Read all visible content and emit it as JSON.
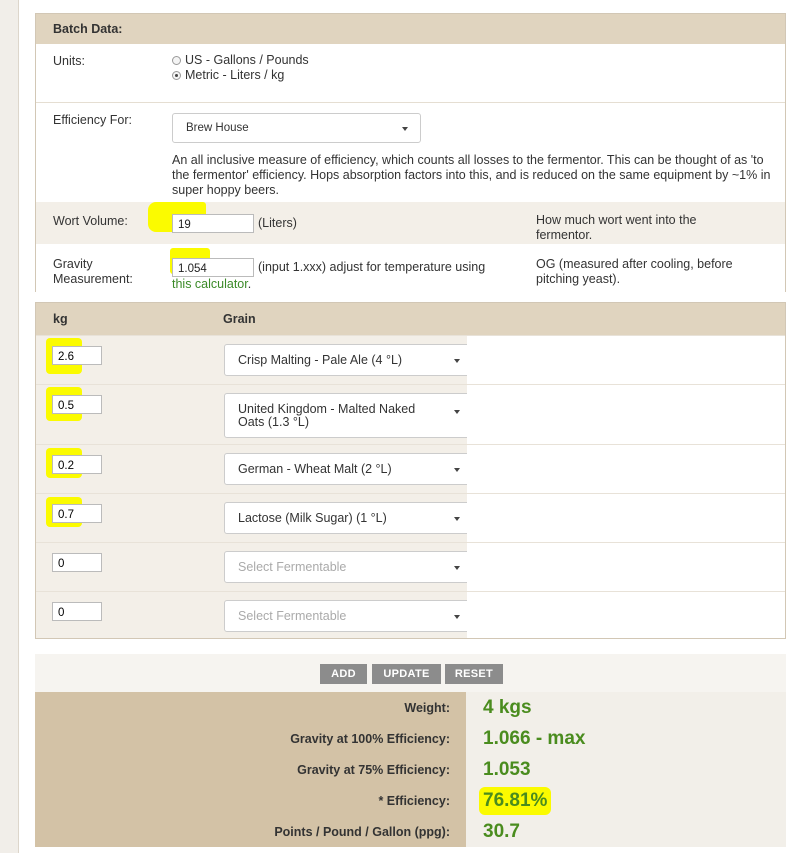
{
  "batch": {
    "header": "Batch Data:",
    "units": {
      "label": "Units:",
      "options": [
        "US - Gallons / Pounds",
        "Metric - Liters / kg"
      ],
      "selected_index": 1
    },
    "efficiency": {
      "label": "Efficiency For:",
      "selected": "Brew House",
      "description": "An all inclusive measure of efficiency, which counts all losses to the fermentor. This can be thought of as 'to the fermentor' efficiency. Hops absorption factors into this, and is reduced on the same equipment by ~1% in super hoppy beers."
    },
    "wort_volume": {
      "label": "Wort Volume:",
      "value": "19",
      "unit": "(Liters)",
      "note": "How much wort went into the fermentor."
    },
    "gravity": {
      "label": "Gravity Measurement:",
      "value": "1.054",
      "hint": "(input 1.xxx) adjust for temperature using",
      "link": "this calculator",
      "link_suffix": ".",
      "note": "OG (measured after cooling, before pitching yeast)."
    }
  },
  "grain_table": {
    "headers": {
      "kg": "kg",
      "grain": "Grain"
    },
    "rows": [
      {
        "kg": "2.6",
        "grain": "Crisp Malting - Pale Ale (4 °L)",
        "highlighted": true
      },
      {
        "kg": "0.5",
        "grain": "United Kingdom - Malted Naked Oats (1.3 °L)",
        "highlighted": true
      },
      {
        "kg": "0.2",
        "grain": "German - Wheat Malt (2 °L)",
        "highlighted": true
      },
      {
        "kg": "0.7",
        "grain": "Lactose (Milk Sugar) (1 °L)",
        "highlighted": true
      },
      {
        "kg": "0",
        "grain": "Select Fermentable",
        "placeholder": true
      },
      {
        "kg": "0",
        "grain": "Select Fermentable",
        "placeholder": true
      }
    ]
  },
  "buttons": {
    "add": "ADD",
    "update": "UPDATE",
    "reset": "RESET"
  },
  "results": {
    "weight": {
      "label": "Weight:",
      "value": "4 kgs"
    },
    "gravity_100": {
      "label": "Gravity at 100% Efficiency:",
      "value": "1.066 - max"
    },
    "gravity_75": {
      "label": "Gravity at 75% Efficiency:",
      "value": "1.053"
    },
    "efficiency": {
      "label": "* Efficiency:",
      "value": "76.81%"
    },
    "ppg": {
      "label": "Points / Pound / Gallon (ppg):",
      "value": "30.7"
    }
  },
  "colors": {
    "header_bg": "#e0d4bf",
    "result_label_bg": "#d3c2a6",
    "result_value": "#4a8c1e",
    "highlight": "#fbfb00",
    "link": "#3b8a28"
  }
}
